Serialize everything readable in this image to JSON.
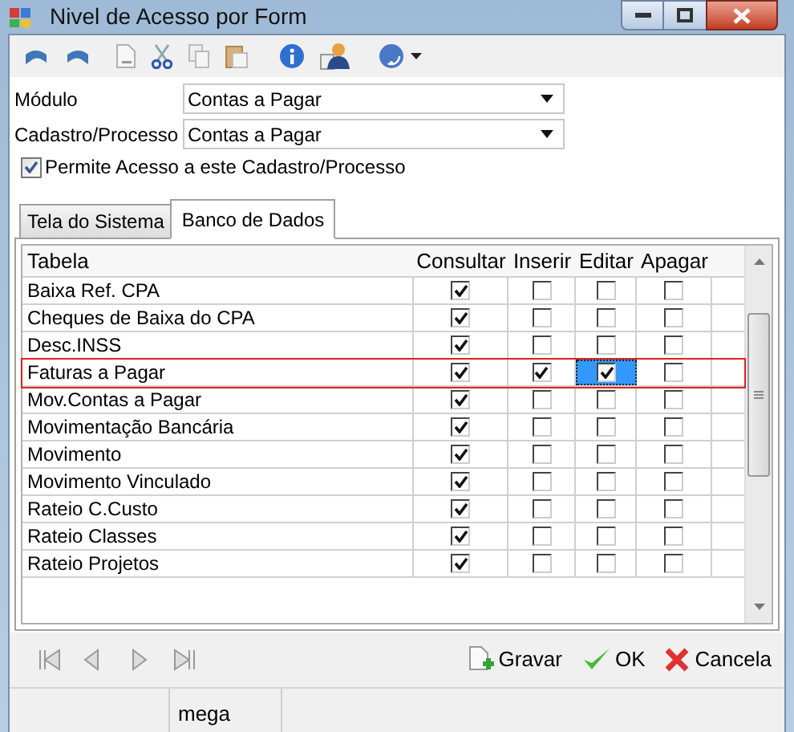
{
  "window": {
    "title": "Nivel de Acesso por Form"
  },
  "fields": [
    {
      "label": "Módulo",
      "value": "Contas a Pagar"
    },
    {
      "label": "Cadastro/Processo",
      "value": "Contas a Pagar"
    }
  ],
  "permit": {
    "label": "Permite Acesso a este Cadastro/Processo",
    "checked": true
  },
  "tabs": [
    {
      "label": "Tela do Sistema",
      "selected": false
    },
    {
      "label": "Banco de Dados",
      "selected": true
    }
  ],
  "table": {
    "columns": [
      "Tabela",
      "Consultar",
      "Inserir",
      "Editar",
      "Apagar"
    ],
    "rows": [
      {
        "name": "Baixa Ref. CPA",
        "selected": false,
        "cells": [
          {
            "checked": true,
            "focused": false
          },
          {
            "checked": false,
            "focused": false
          },
          {
            "checked": false,
            "focused": false
          },
          {
            "checked": false,
            "focused": false
          }
        ]
      },
      {
        "name": "Cheques de Baixa do CPA",
        "selected": false,
        "cells": [
          {
            "checked": true,
            "focused": false
          },
          {
            "checked": false,
            "focused": false
          },
          {
            "checked": false,
            "focused": false
          },
          {
            "checked": false,
            "focused": false
          }
        ]
      },
      {
        "name": "Desc.INSS",
        "selected": false,
        "cells": [
          {
            "checked": true,
            "focused": false
          },
          {
            "checked": false,
            "focused": false
          },
          {
            "checked": false,
            "focused": false
          },
          {
            "checked": false,
            "focused": false
          }
        ]
      },
      {
        "name": "Faturas a Pagar",
        "selected": true,
        "cells": [
          {
            "checked": true,
            "focused": false
          },
          {
            "checked": true,
            "focused": false
          },
          {
            "checked": true,
            "focused": true
          },
          {
            "checked": false,
            "focused": false
          }
        ]
      },
      {
        "name": "Mov.Contas a Pagar",
        "selected": false,
        "cells": [
          {
            "checked": true,
            "focused": false
          },
          {
            "checked": false,
            "focused": false
          },
          {
            "checked": false,
            "focused": false
          },
          {
            "checked": false,
            "focused": false
          }
        ]
      },
      {
        "name": "Movimentação Bancária",
        "selected": false,
        "cells": [
          {
            "checked": true,
            "focused": false
          },
          {
            "checked": false,
            "focused": false
          },
          {
            "checked": false,
            "focused": false
          },
          {
            "checked": false,
            "focused": false
          }
        ]
      },
      {
        "name": "Movimento",
        "selected": false,
        "cells": [
          {
            "checked": true,
            "focused": false
          },
          {
            "checked": false,
            "focused": false
          },
          {
            "checked": false,
            "focused": false
          },
          {
            "checked": false,
            "focused": false
          }
        ]
      },
      {
        "name": "Movimento Vinculado",
        "selected": false,
        "cells": [
          {
            "checked": true,
            "focused": false
          },
          {
            "checked": false,
            "focused": false
          },
          {
            "checked": false,
            "focused": false
          },
          {
            "checked": false,
            "focused": false
          }
        ]
      },
      {
        "name": "Rateio C.Custo",
        "selected": false,
        "cells": [
          {
            "checked": true,
            "focused": false
          },
          {
            "checked": false,
            "focused": false
          },
          {
            "checked": false,
            "focused": false
          },
          {
            "checked": false,
            "focused": false
          }
        ]
      },
      {
        "name": "Rateio Classes",
        "selected": false,
        "cells": [
          {
            "checked": true,
            "focused": false
          },
          {
            "checked": false,
            "focused": false
          },
          {
            "checked": false,
            "focused": false
          },
          {
            "checked": false,
            "focused": false
          }
        ]
      },
      {
        "name": "Rateio Projetos",
        "selected": false,
        "cells": [
          {
            "checked": true,
            "focused": false
          },
          {
            "checked": false,
            "focused": false
          },
          {
            "checked": false,
            "focused": false
          },
          {
            "checked": false,
            "focused": false
          }
        ]
      }
    ]
  },
  "buttons": [
    {
      "kind": "save",
      "label": "Gravar"
    },
    {
      "kind": "ok",
      "label": "OK"
    },
    {
      "kind": "cancel",
      "label": "Cancela"
    }
  ],
  "status_bar": {
    "user": "mega"
  }
}
